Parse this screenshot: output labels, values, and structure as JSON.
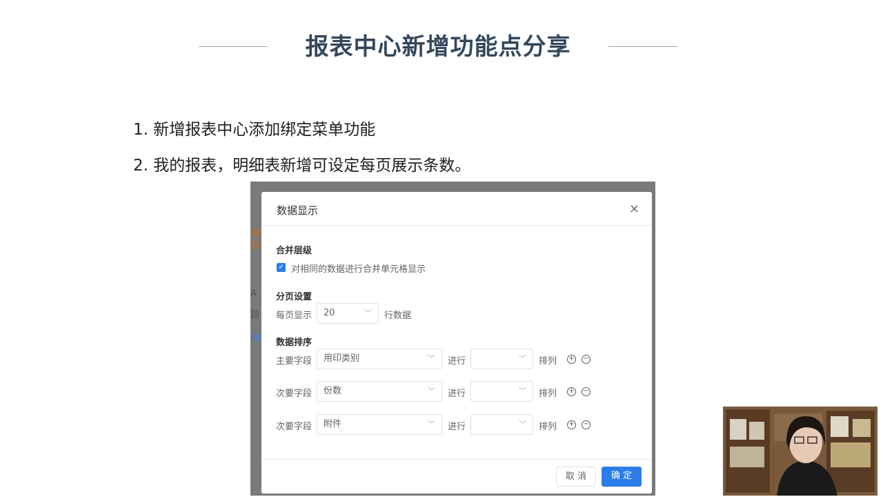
{
  "slide": {
    "title": "报表中心新增功能点分享",
    "bullets": [
      "1. 新增报表中心添加绑定菜单功能",
      "2. 我的报表，明细表新增可设定每页展示条数。"
    ]
  },
  "dialog": {
    "title": "数据显示",
    "close_icon": "×",
    "merge": {
      "heading": "合并层级",
      "checkbox_label": "对相同的数据进行合并单元格显示",
      "checked": true
    },
    "paging": {
      "heading": "分页设置",
      "prefix": "每页显示",
      "value": "20",
      "suffix": "行数据"
    },
    "sort": {
      "heading": "数据排序",
      "rows": [
        {
          "label": "主要字段",
          "field": "用印类别",
          "mid": "进行",
          "order": "",
          "tail": "排列"
        },
        {
          "label": "次要字段",
          "field": "份数",
          "mid": "进行",
          "order": "",
          "tail": "排列"
        },
        {
          "label": "次要字段",
          "field": "附件",
          "mid": "进行",
          "order": "",
          "tail": "排列"
        }
      ]
    },
    "cancel": "取 消",
    "confirm": "确 定"
  },
  "background_fragments": [
    "没拍",
    "器",
    "A",
    "题",
    "问题"
  ],
  "colors": {
    "accent": "#2b7de9",
    "title": "#33475b"
  }
}
